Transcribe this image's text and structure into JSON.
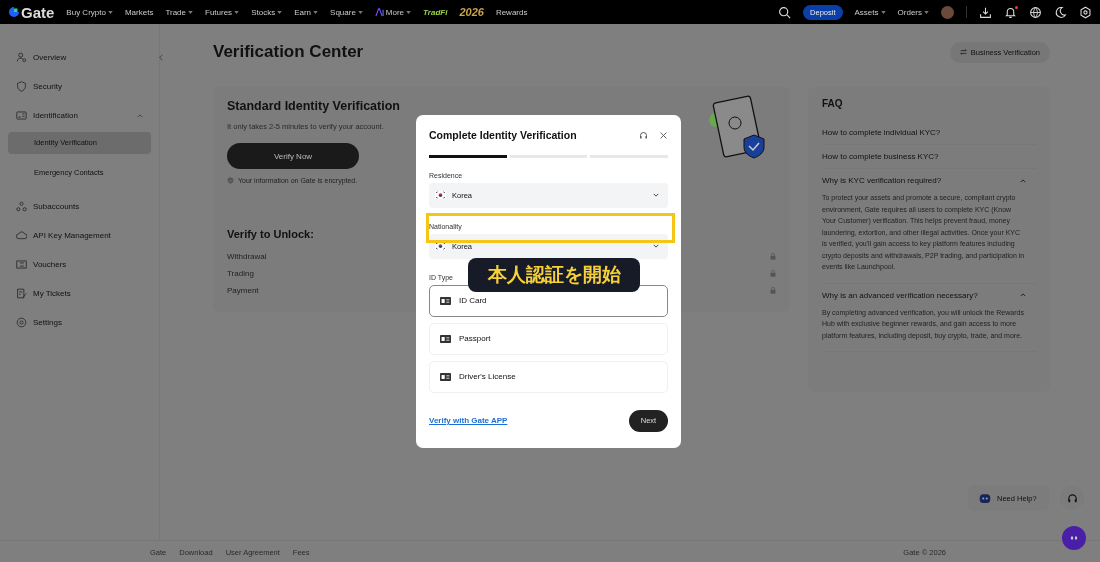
{
  "topbar": {
    "logo": "Gate",
    "nav": [
      {
        "label": "Buy Crypto",
        "kind": "link",
        "dropdown": true
      },
      {
        "label": "Markets",
        "kind": "link"
      },
      {
        "label": "Trade",
        "kind": "link",
        "dropdown": true
      },
      {
        "label": "Futures",
        "kind": "link",
        "dropdown": true
      },
      {
        "label": "Stocks",
        "kind": "link",
        "dropdown": true
      },
      {
        "label": "Earn",
        "kind": "link",
        "dropdown": true
      },
      {
        "label": "Square",
        "kind": "link",
        "dropdown": true
      },
      {
        "label": "More",
        "kind": "ai",
        "dropdown": true
      },
      {
        "label": "TradFi",
        "kind": "tradfi"
      },
      {
        "label": "2026",
        "kind": "emblem"
      },
      {
        "label": "Rewards",
        "kind": "link"
      }
    ],
    "deposit": "Deposit",
    "menus": [
      {
        "label": "Assets"
      },
      {
        "label": "Orders"
      }
    ],
    "notification_dot": true
  },
  "sidebar": {
    "items": [
      {
        "label": "Overview"
      },
      {
        "label": "Security"
      },
      {
        "label": "Identification",
        "expanded": true,
        "children": [
          {
            "label": "Identity Verification",
            "selected": true
          },
          {
            "label": "Emergency Contacts",
            "selected": false
          }
        ]
      },
      {
        "label": "Subaccounts"
      },
      {
        "label": "API Key Management"
      },
      {
        "label": "Vouchers"
      },
      {
        "label": "My Tickets"
      },
      {
        "label": "Settings"
      }
    ]
  },
  "page": {
    "title": "Verification Center",
    "business_button": "Business Verification"
  },
  "card": {
    "title": "Standard Identity Verification",
    "description": "It only takes 2-5 minutes to verify your account.",
    "button": "Verify Now",
    "note": "Your information on Gate is encrypted.",
    "unlock_title": "Verify to Unlock:",
    "unlock_items": [
      {
        "label": "Withdrawal",
        "locked": true
      },
      {
        "label": "Trading",
        "locked": true
      },
      {
        "label": "Payment",
        "locked": true
      }
    ]
  },
  "faq": {
    "title": "FAQ",
    "items": [
      {
        "question": "How to complete individual KYC?",
        "expanded": false
      },
      {
        "question": "How to complete business KYC?",
        "expanded": false
      },
      {
        "question": "Why is KYC verification required?",
        "expanded": true,
        "answer": "To protect your assets and promote a secure, compliant crypto environment, Gate requires all users to complete KYC (Know Your Customer) verification. This helps prevent fraud, money laundering, extortion, and other illegal activities. Once your KYC is verified, you'll gain access to key platform features including crypto deposits and withdrawals, P2P trading, and participation in events like Launchpool."
      },
      {
        "question": "Why is an advanced verification necessary?",
        "expanded": true,
        "answer": "By completing advanced verification, you will unlock the Rewards Hub with exclusive beginner rewards, and gain access to more platform features, including deposit, buy crypto, trade, and more."
      }
    ]
  },
  "footer": {
    "links": [
      "Gate",
      "Download",
      "User Agreement",
      "Fees"
    ],
    "copyright": "Gate © 2026"
  },
  "help": {
    "label": "Need Help?"
  },
  "modal": {
    "title": "Complete Identity Verification",
    "steps": [
      {
        "selected": true
      },
      {
        "selected": false
      },
      {
        "selected": false
      }
    ],
    "fields": [
      {
        "label": "Residence",
        "value": "Korea"
      },
      {
        "label": "Nationality",
        "value": "Korea",
        "highlighted": true
      }
    ],
    "id_type_label": "ID Type",
    "id_types": [
      {
        "label": "ID Card",
        "selected": true
      },
      {
        "label": "Passport",
        "selected": false
      },
      {
        "label": "Driver's License",
        "selected": false
      }
    ],
    "app_link": "Verify with Gate APP",
    "next": "Next"
  },
  "caption": "本人認証を開始"
}
